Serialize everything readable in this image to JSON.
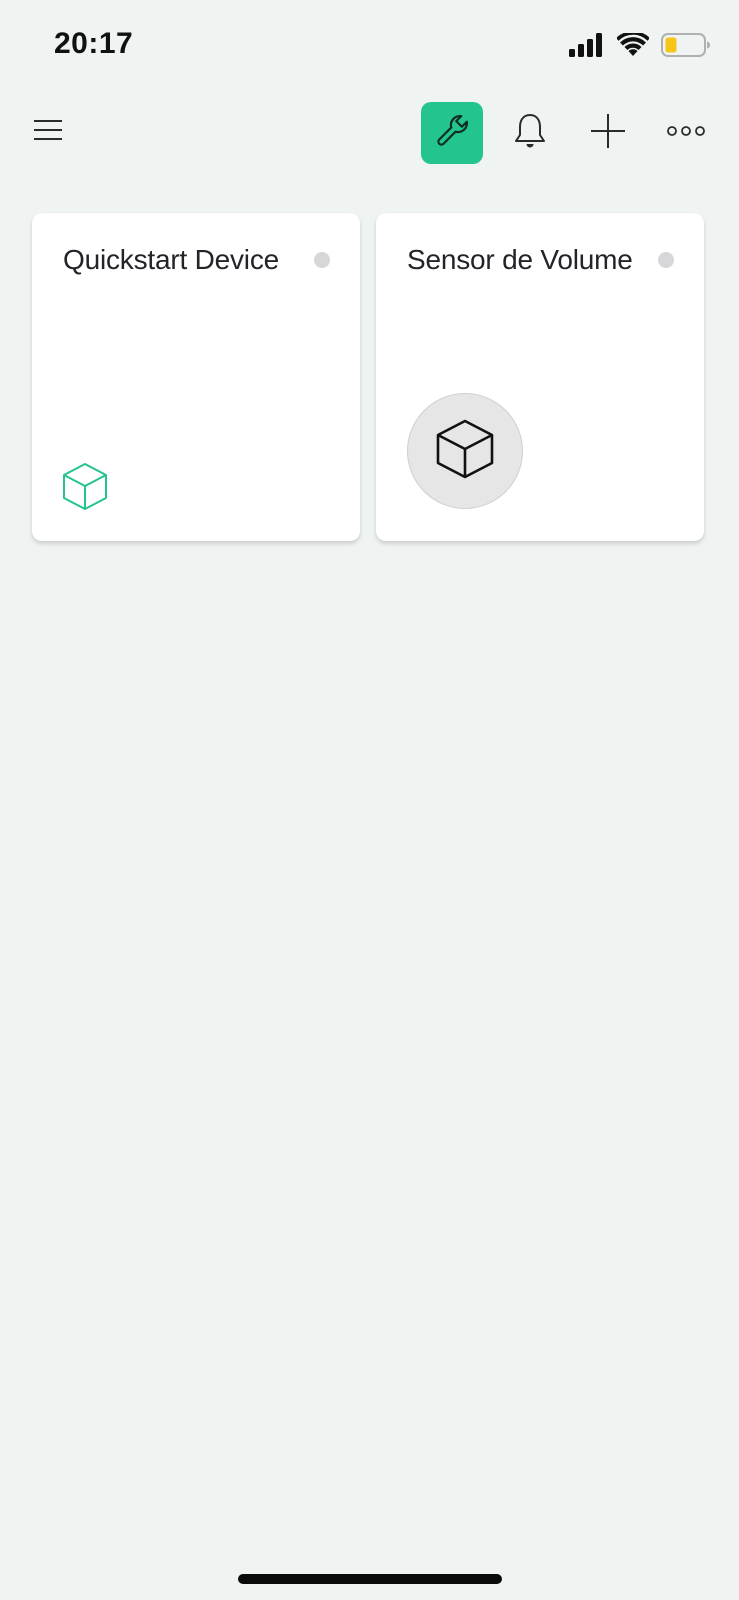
{
  "status_bar": {
    "time": "20:17",
    "icons": [
      "cellular-signal-icon",
      "wifi-icon",
      "battery-icon"
    ],
    "battery_color": "#F5C518"
  },
  "toolbar": {
    "menu_icon": "hamburger-menu-icon",
    "actions": [
      {
        "icon": "wrench-icon",
        "active": true
      },
      {
        "icon": "bell-icon",
        "active": false
      },
      {
        "icon": "plus-icon",
        "active": false
      },
      {
        "icon": "more-icon",
        "active": false
      }
    ],
    "accent_color": "#23C48E"
  },
  "devices": [
    {
      "name": "Quickstart Device",
      "status": "offline",
      "icon": "cube-icon",
      "icon_color": "#23C48E"
    },
    {
      "name": "Sensor de Volume",
      "status": "offline",
      "icon": "cube-icon",
      "icon_color": "#111111"
    }
  ],
  "colors": {
    "background": "#EFF3F2",
    "card": "#FFFFFF",
    "status_dot_offline": "#D7D7D9"
  }
}
